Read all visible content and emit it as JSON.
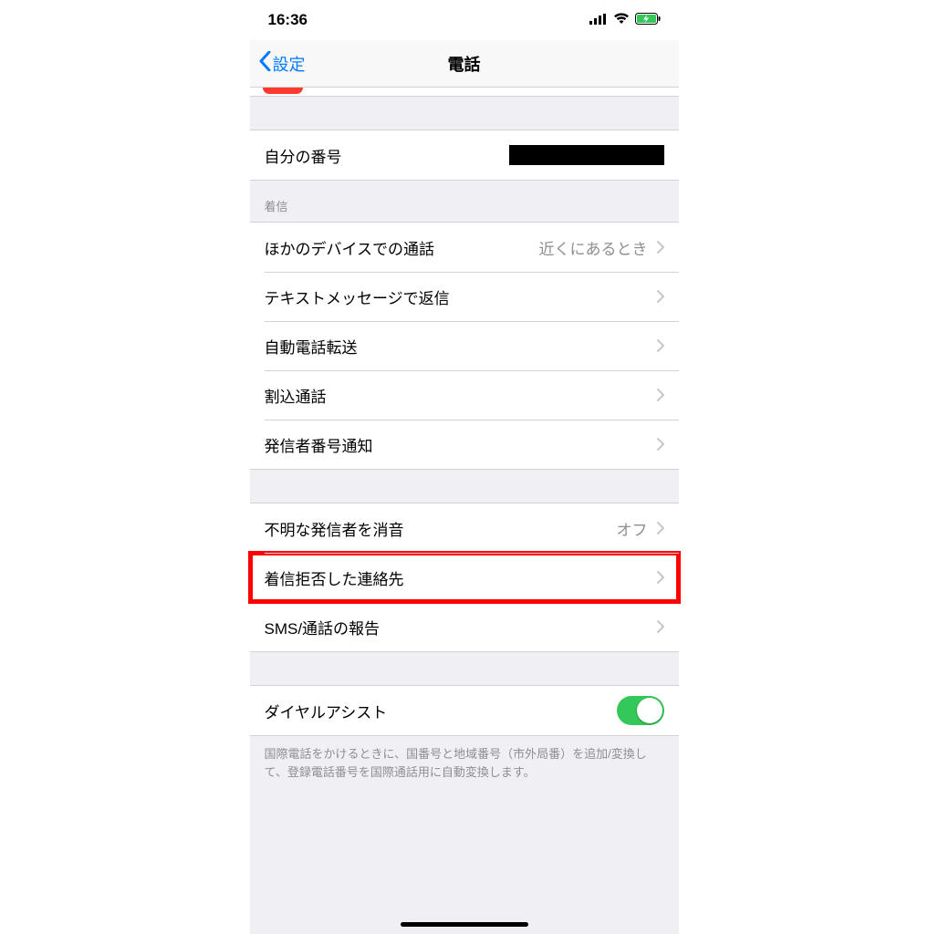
{
  "status": {
    "time": "16:36"
  },
  "nav": {
    "back_label": "設定",
    "title": "電話"
  },
  "sections": {
    "my_number": {
      "label": "自分の番号"
    },
    "incoming_header": "着信",
    "incoming": [
      {
        "label": "ほかのデバイスでの通話",
        "value": "近くにあるとき"
      },
      {
        "label": "テキストメッセージで返信",
        "value": ""
      },
      {
        "label": "自動電話転送",
        "value": ""
      },
      {
        "label": "割込通話",
        "value": ""
      },
      {
        "label": "発信者番号通知",
        "value": ""
      }
    ],
    "block": [
      {
        "label": "不明な発信者を消音",
        "value": "オフ"
      },
      {
        "label": "着信拒否した連絡先",
        "value": ""
      },
      {
        "label": "SMS/通話の報告",
        "value": ""
      }
    ],
    "dial_assist": {
      "label": "ダイヤルアシスト",
      "footer": "国際電話をかけるときに、国番号と地域番号（市外局番）を追加/変換して、登録電話番号を国際通話用に自動変換します。"
    }
  }
}
